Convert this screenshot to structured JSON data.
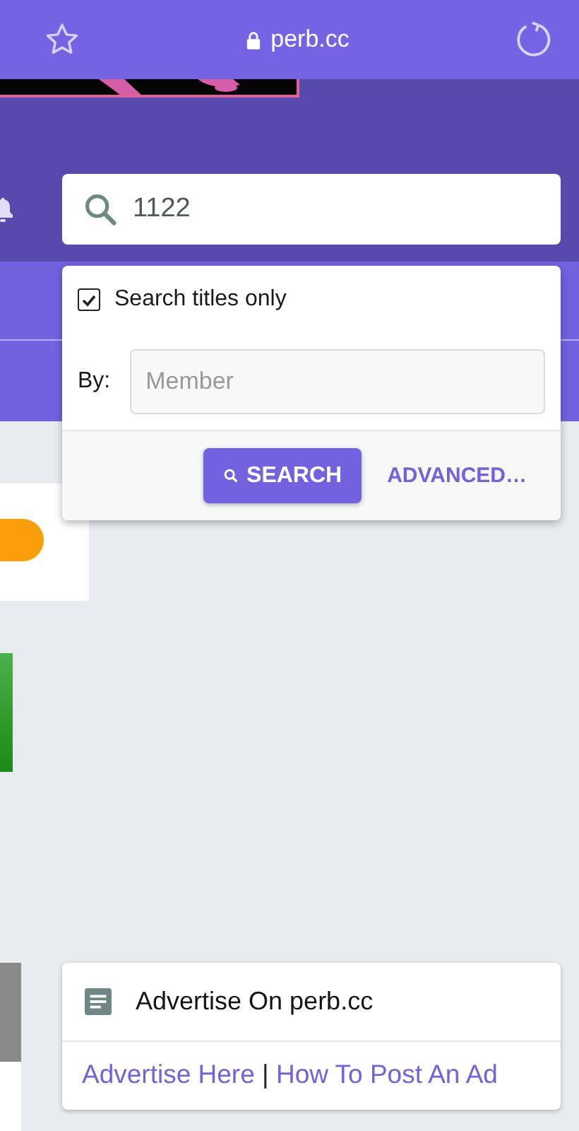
{
  "browser": {
    "url": "perb.cc"
  },
  "search": {
    "value": "1122"
  },
  "search_menu": {
    "titles_only": {
      "label": "Search titles only",
      "checked": true
    },
    "by_label": "By:",
    "member_placeholder": "Member",
    "search_button": "SEARCH",
    "advanced_link": "ADVANCED…"
  },
  "ad_card": {
    "title": "Advertise On perb.cc",
    "links": [
      "Advertise Here",
      "How To Post An Ad"
    ],
    "separator": "|"
  }
}
